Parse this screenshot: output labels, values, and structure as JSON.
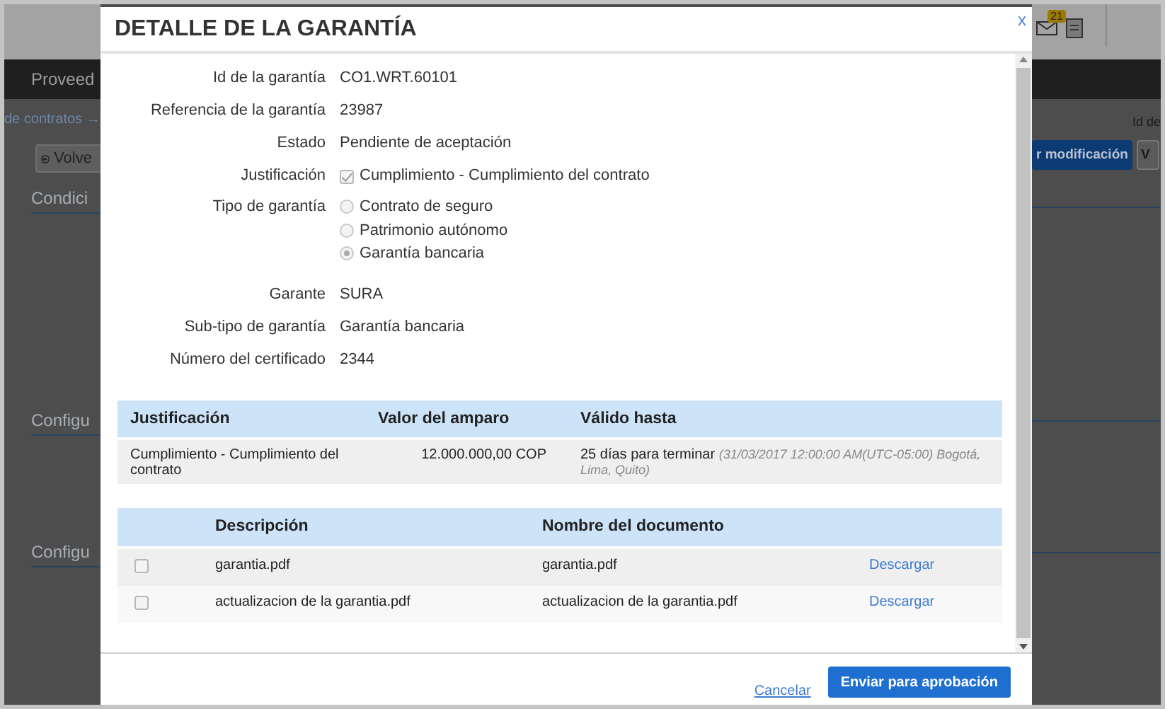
{
  "background": {
    "mail_badge": "21",
    "nav_label": "Proveed",
    "breadcrumb": "de contratos →",
    "right_label": "Id de",
    "back_button": "Volve",
    "action_buttons": [
      {
        "label": "r modificación",
        "kind": "primary"
      },
      {
        "label": "V",
        "kind": "secondary"
      }
    ],
    "sections": [
      "Condici",
      "Configu",
      "Configu"
    ]
  },
  "modal": {
    "title": "DETALLE DE LA GARANTÍA",
    "close": "x",
    "fields": [
      {
        "kind": "text",
        "label": "Id de la garantía",
        "value": "CO1.WRT.60101"
      },
      {
        "kind": "text",
        "label": "Referencia de la garantía",
        "value": "23987"
      },
      {
        "kind": "text",
        "label": "Estado",
        "value": "Pendiente de aceptación"
      },
      {
        "kind": "checkbox",
        "label": "Justificación",
        "options": [
          {
            "label": "Cumplimiento - Cumplimiento del contrato",
            "checked": true
          }
        ]
      },
      {
        "kind": "radio",
        "label": "Tipo de garantía",
        "options": [
          {
            "label": "Contrato de seguro",
            "selected": false
          },
          {
            "label": "Patrimonio autónomo",
            "selected": false
          },
          {
            "label": "Garantía bancaria",
            "selected": true
          }
        ]
      },
      {
        "kind": "text",
        "label": "Garante",
        "value": "SURA"
      },
      {
        "kind": "text",
        "label": "Sub-tipo de garantía",
        "value": "Garantía bancaria"
      },
      {
        "kind": "text",
        "label": "Número del certificado",
        "value": "2344"
      }
    ],
    "coverage_table": {
      "columns": [
        "Justificación",
        "Valor del amparo",
        "Válido hasta"
      ],
      "rows": [
        {
          "justification": "Cumplimiento - Cumplimiento del contrato",
          "amount": "12.000.000,00 COP",
          "valid_until": "25 días para terminar",
          "valid_detail": "(31/03/2017 12:00:00 AM(UTC-05:00) Bogotá, Lima, Quito)"
        }
      ]
    },
    "documents_table": {
      "columns": [
        "Descripción",
        "Nombre del documento"
      ],
      "rows": [
        {
          "checked": false,
          "description": "garantia.pdf",
          "document_name": "garantia.pdf",
          "action": "Descargar"
        },
        {
          "checked": false,
          "description": "actualizacion de la garantia.pdf",
          "document_name": "actualizacion de la garantia.pdf",
          "action": "Descargar"
        }
      ]
    },
    "footer": {
      "cancel": "Cancelar",
      "submit": "Enviar para aprobación"
    }
  }
}
